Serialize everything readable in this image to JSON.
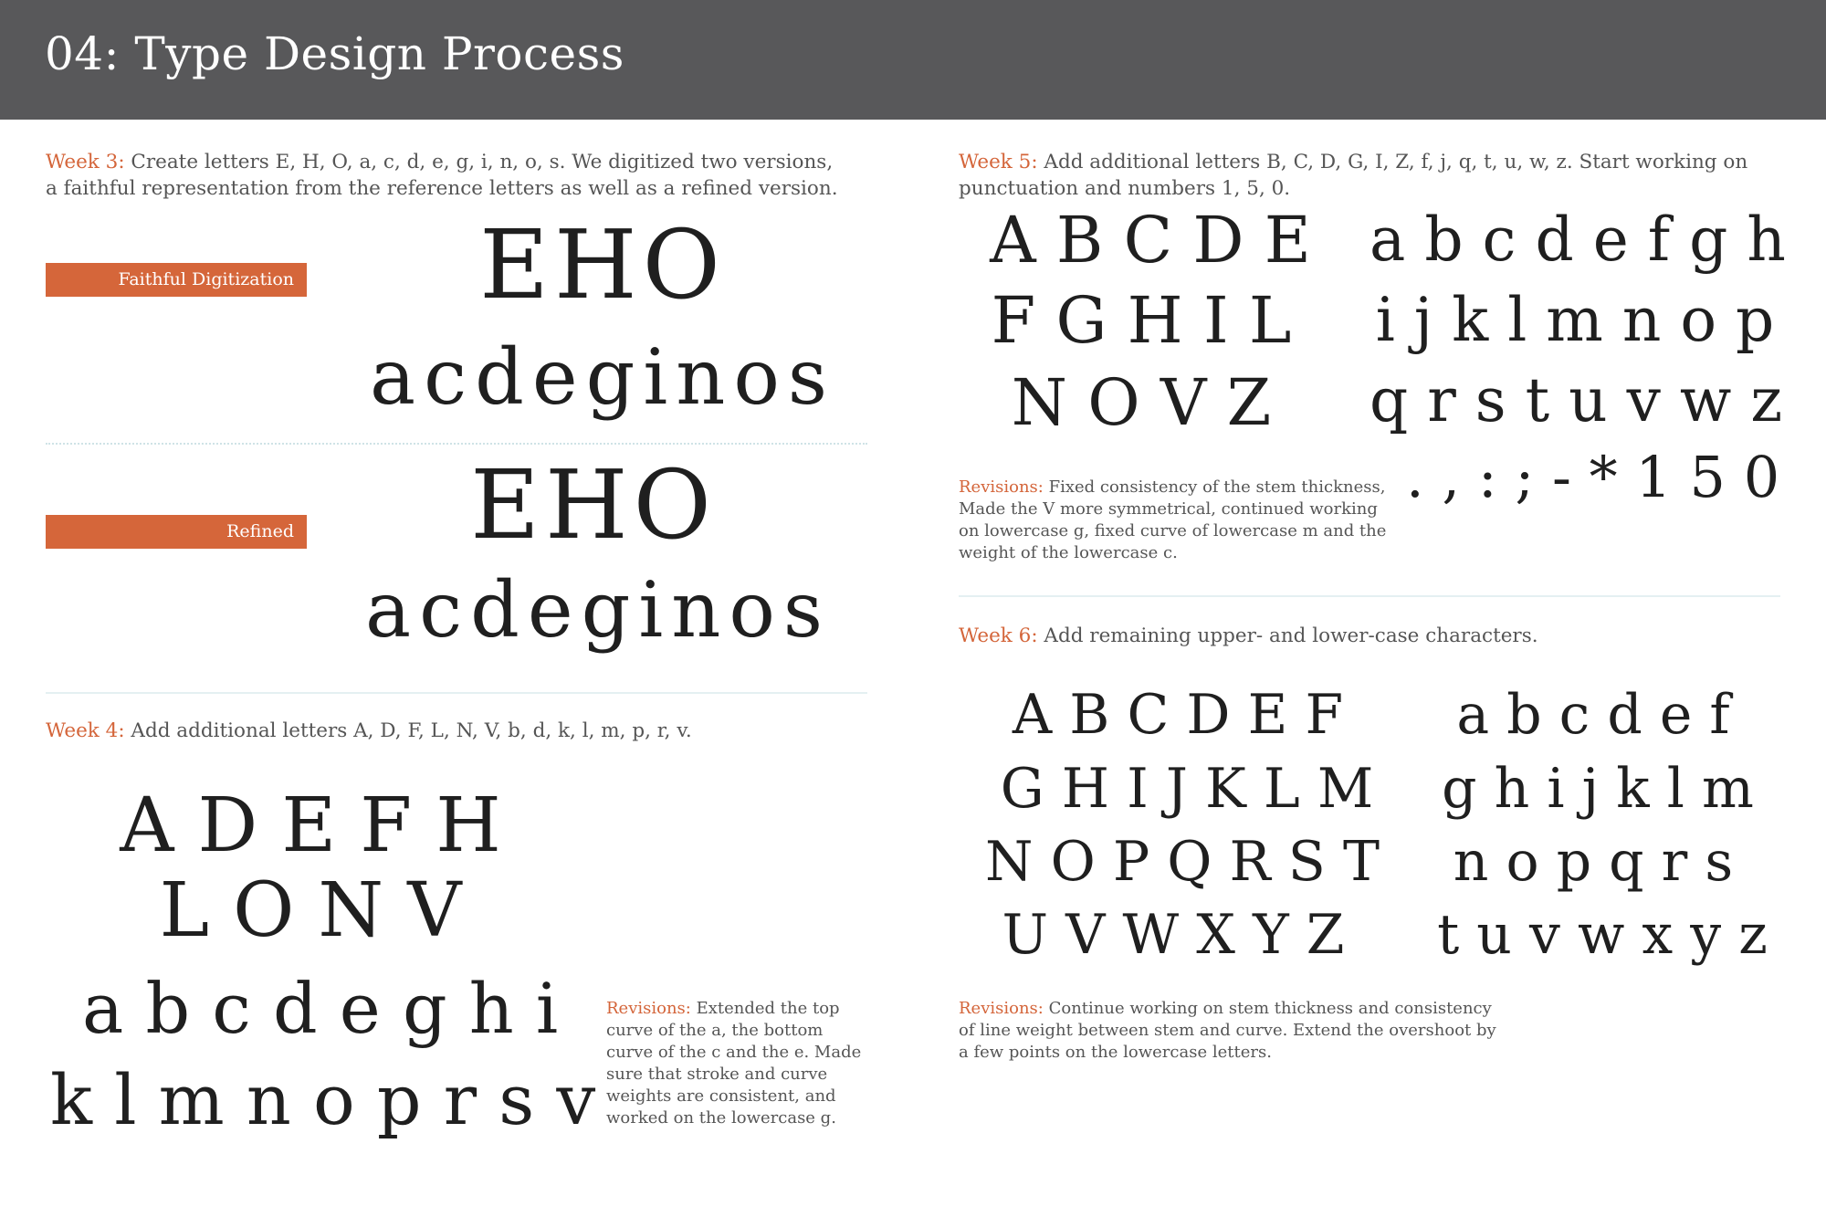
{
  "header": {
    "title": "04: Type Design Process"
  },
  "week3": {
    "label": "Week 3:",
    "text": " Create letters E, H, O, a, c, d, e, g, i, n, o, s. We digitized two versions, a faithful representation from the reference letters as well as a refined version.",
    "faithful": {
      "tag": "Faithful Digitization",
      "upper": "EHO",
      "lower": "acdeginos"
    },
    "refined": {
      "tag": "Refined",
      "upper": "EHO",
      "lower": "acdeginos"
    }
  },
  "week4": {
    "label": "Week 4:",
    "text": " Add additional letters A, D, F, L, N, V, b, d, k, l, m, p, r, v.",
    "rows": [
      "A D E F H",
      "L O N V",
      "a b c d e g h i",
      "k l m n o p r s v"
    ],
    "revisions_label": "Revisions:",
    "revisions_text": " Extended the top curve of the a, the bottom curve of the c and the e. Made sure that stroke and curve weights are consistent, and worked on the lowercase g."
  },
  "week5": {
    "label": "Week 5:",
    "text": " Add additional letters B, C, D, G, I, Z, f, j, q, t, u, w, z. Start working on punctuation and numbers 1, 5, 0.",
    "upper_rows": [
      "A B C D E",
      "F G H I L",
      "N O V Z"
    ],
    "lower_rows": [
      "a b c d e f g h",
      "i j k l m n o p",
      "q r s t u v w z"
    ],
    "punct": ". , : ; - * 1 5 0",
    "revisions_label": "Revisions:",
    "revisions_text": " Fixed consistency of the stem thickness, Made the V more symmetrical, continued working on lowercase g, fixed curve of lowercase m and the weight of the lowercase c."
  },
  "week6": {
    "label": "Week 6:",
    "text": " Add remaining upper- and lower-case characters.",
    "upper_rows": [
      "A B C D E F",
      "G H I J K L M",
      "N O P Q R S T",
      "U V W X Y Z"
    ],
    "lower_rows": [
      "a b c d e f",
      "g h i j k l m",
      "n o p q r s",
      "t u v w x y z"
    ],
    "revisions_label": "Revisions:",
    "revisions_text": " Continue working on stem thickness and consistency of line weight between stem and curve. Extend the overshoot by a few points on the lowercase letters."
  }
}
